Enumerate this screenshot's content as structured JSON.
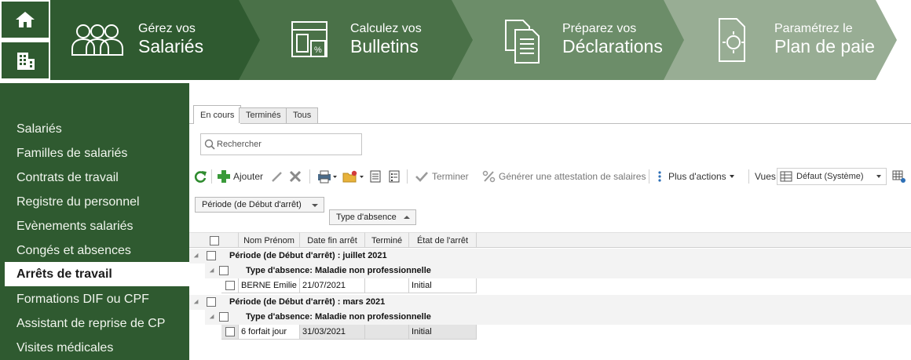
{
  "nav": [
    {
      "line1": "Gérez vos",
      "line2": "Salariés",
      "icon": "users-icon"
    },
    {
      "line1": "Calculez vos",
      "line2": "Bulletins",
      "icon": "payslip-icon"
    },
    {
      "line1": "Préparez vos",
      "line2": "Déclarations",
      "icon": "documents-icon"
    },
    {
      "line1": "Paramétrez le",
      "line2": "Plan de paie",
      "icon": "settings-document-icon"
    }
  ],
  "nav_colors": [
    "#2f5a30",
    "#4a7148",
    "#6c8d69",
    "#98ad94"
  ],
  "sidebar": {
    "items": [
      {
        "label": "Salariés"
      },
      {
        "label": "Familles de salariés"
      },
      {
        "label": "Contrats de travail"
      },
      {
        "label": "Registre du personnel"
      },
      {
        "label": "Evènements salariés"
      },
      {
        "label": "Congés et absences"
      },
      {
        "label": "Arrêts de travail"
      },
      {
        "label": "Formations DIF ou CPF"
      },
      {
        "label": "Assistant de reprise de CP"
      },
      {
        "label": "Visites médicales"
      }
    ],
    "active": "Arrêts de travail"
  },
  "tabs": [
    {
      "label": "En cours"
    },
    {
      "label": "Terminés"
    },
    {
      "label": "Tous"
    }
  ],
  "search": {
    "placeholder": "Rechercher"
  },
  "toolbar": {
    "add": "Ajouter",
    "finish": "Terminer",
    "generate": "Générer une attestation de salaires",
    "more": "Plus d'actions",
    "views_label": "Vues",
    "view_value": "Défaut (Système)"
  },
  "grouping": {
    "chip1": "Période (de Début d'arrêt)",
    "chip2": "Type d'absence"
  },
  "grid": {
    "headers": [
      "Nom Prénom",
      "Date fin arrêt",
      "Terminé",
      "État de l'arrêt"
    ],
    "groups": [
      {
        "label": "Période (de Début d'arrêt) : juillet 2021",
        "subgroup": "Type d'absence: Maladie non professionnelle",
        "rows": [
          {
            "name": "BERNE Emilie",
            "date": "21/07/2021",
            "done": "",
            "state": "Initial"
          }
        ]
      },
      {
        "label": "Période (de Début d'arrêt) : mars 2021",
        "subgroup": "Type d'absence: Maladie non professionnelle",
        "rows": [
          {
            "name": "6 forfait jour",
            "date": "31/03/2021",
            "done": "",
            "state": "Initial"
          }
        ]
      }
    ]
  },
  "colors": {
    "brand_green": "#2f5a30",
    "accent_add": "#3a9a3a",
    "accent_delete": "#8a8a8a"
  }
}
